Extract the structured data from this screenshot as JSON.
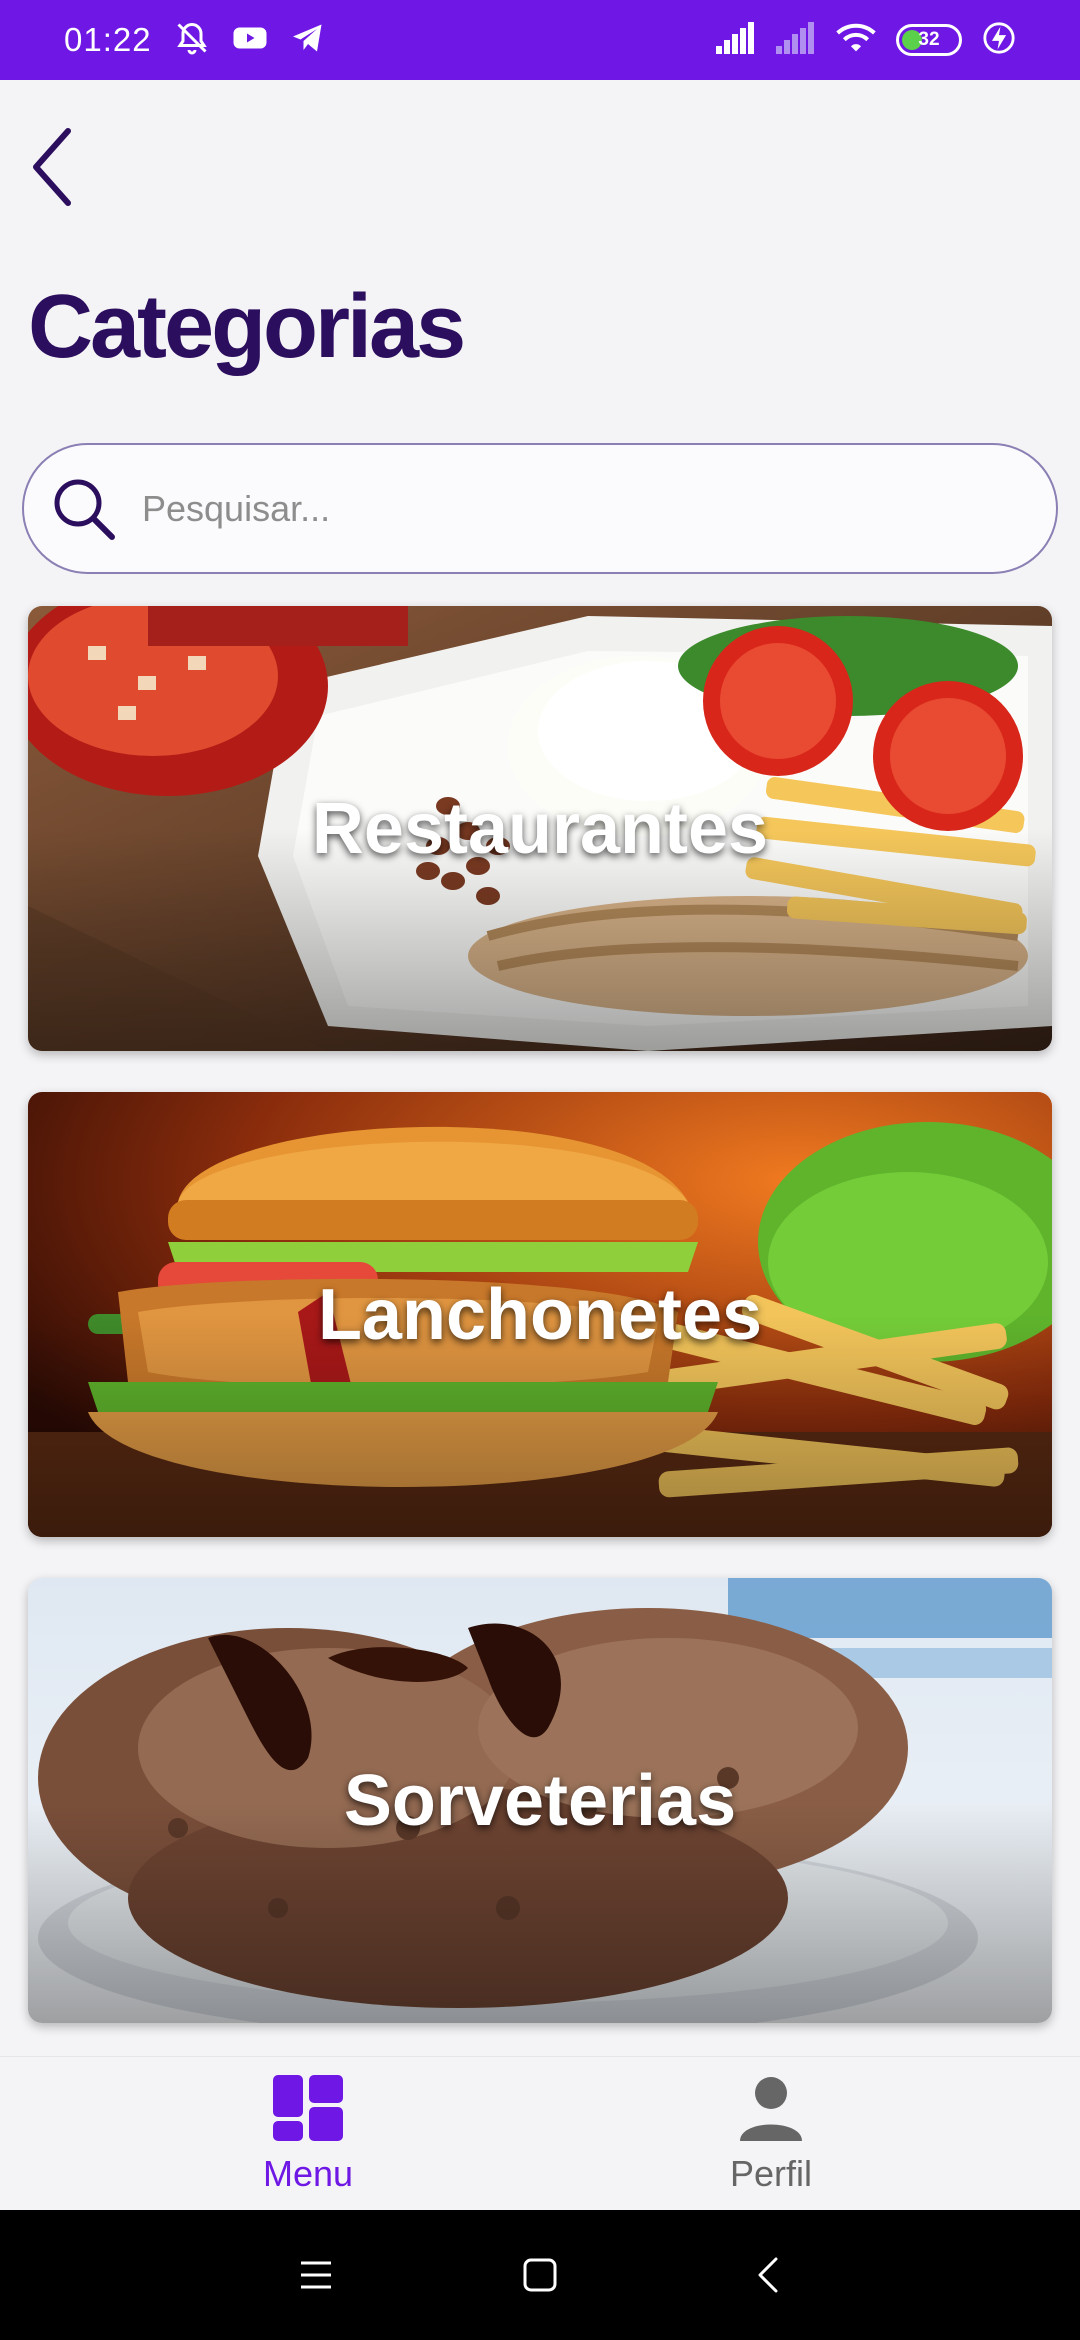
{
  "status_bar": {
    "time": "01:22",
    "battery": "32",
    "icons": [
      "mute-icon",
      "youtube-icon",
      "telegram-icon",
      "signal-icon",
      "signal-off-icon",
      "wifi-icon",
      "battery-icon",
      "charging-icon"
    ]
  },
  "header": {
    "back_icon": "chevron-left-icon",
    "title": "Categorias"
  },
  "search": {
    "placeholder": "Pesquisar...",
    "value": ""
  },
  "categories": [
    {
      "label": "Restaurantes",
      "image": "plate-of-rice-beans-chicken-fries"
    },
    {
      "label": "Lanchonetes",
      "image": "chicken-burger-with-fries"
    },
    {
      "label": "Sorveterias",
      "image": "chocolate-ice-cream-bowl"
    }
  ],
  "bottom_nav": {
    "items": [
      {
        "label": "Menu",
        "icon": "grid-icon",
        "active": true
      },
      {
        "label": "Perfil",
        "icon": "person-icon",
        "active": false
      }
    ]
  },
  "colors": {
    "accent": "#6f17e4",
    "title": "#2c0e5e",
    "background": "#f4f4f6",
    "inactive": "#666666"
  }
}
